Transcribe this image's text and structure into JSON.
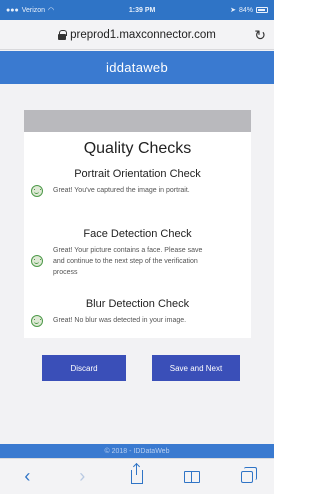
{
  "status_bar": {
    "carrier": "Verizon",
    "time": "1:39 PM",
    "battery": "84%"
  },
  "browser": {
    "url": "preprod1.maxconnector.com"
  },
  "app": {
    "title": "iddataweb"
  },
  "quality": {
    "title": "Quality Checks",
    "checks": [
      {
        "heading": "Portrait Orientation Check",
        "message": "Great! You've captured the image in portrait."
      },
      {
        "heading": "Face Detection Check",
        "message": "Great! Your picture contains a face. Please save and continue to the next step of the verification process"
      },
      {
        "heading": "Blur Detection Check",
        "message": "Great! No blur was detected in your image."
      }
    ]
  },
  "buttons": {
    "discard": "Discard",
    "save_next": "Save and Next"
  },
  "footer": {
    "text": "© 2018 - IDDataWeb"
  },
  "colors": {
    "header_blue": "#3a7ad0",
    "button_blue": "#3a4fb8",
    "success_green": "#4e9a4a"
  }
}
